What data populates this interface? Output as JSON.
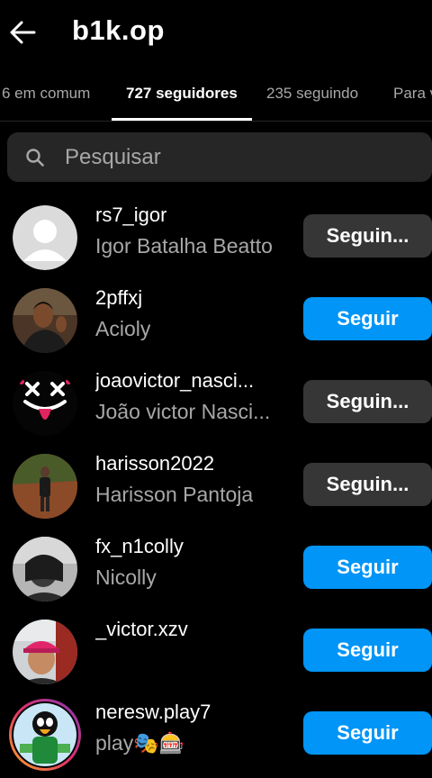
{
  "header": {
    "title": "b1k.op"
  },
  "tabs": [
    {
      "label": "6 em comum"
    },
    {
      "label": "727 seguidores"
    },
    {
      "label": "235 seguindo"
    },
    {
      "label": "Para v"
    }
  ],
  "search": {
    "placeholder": "Pesquisar"
  },
  "users": [
    {
      "username": "rs7_igor",
      "fullname": "Igor Batalha Beatto",
      "button": "Seguin..."
    },
    {
      "username": "2pffxj",
      "fullname": "Acioly",
      "button": "Seguir"
    },
    {
      "username": "joaovictor_nasci...",
      "fullname": "João victor Nasci...",
      "button": "Seguin..."
    },
    {
      "username": "harisson2022",
      "fullname": "Harisson Pantoja",
      "button": "Seguin..."
    },
    {
      "username": "fx_n1colly",
      "fullname": "Nicolly",
      "button": "Seguir"
    },
    {
      "username": "_victor.xzv",
      "fullname": "",
      "button": "Seguir"
    },
    {
      "username": "neresw.play7",
      "fullname": "play🎭🎰",
      "button": "Seguir"
    }
  ],
  "colors": {
    "background": "#000000",
    "follow_button": "#0095f6",
    "following_button": "#363636",
    "secondary_text": "#a8a8a8"
  }
}
